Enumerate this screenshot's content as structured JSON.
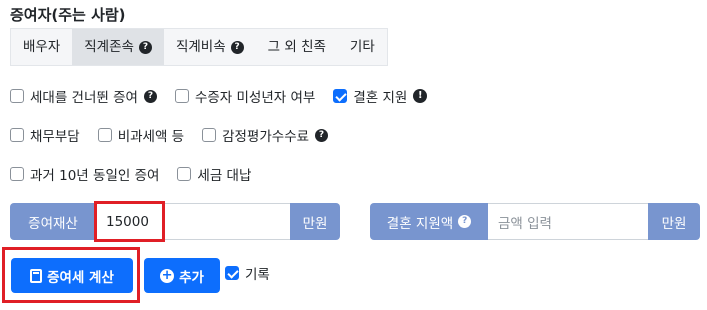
{
  "section": {
    "title": "증여자(주는 사람)"
  },
  "tabs": [
    {
      "label": "배우자",
      "help": false,
      "active": false
    },
    {
      "label": "직계존속",
      "help": true,
      "active": true
    },
    {
      "label": "직계비속",
      "help": true,
      "active": false
    },
    {
      "label": "그 외 친족",
      "help": false,
      "active": false
    },
    {
      "label": "기타",
      "help": false,
      "active": false
    }
  ],
  "options": {
    "row1": [
      {
        "label": "세대를 건너뛴 증여",
        "checked": false,
        "icon": "question-circle-icon"
      },
      {
        "label": "수증자 미성년자 여부",
        "checked": false
      },
      {
        "label": "결혼 지원",
        "checked": true,
        "icon": "exclamation-circle-icon"
      }
    ],
    "row2": [
      {
        "label": "채무부담",
        "checked": false
      },
      {
        "label": "비과세액 등",
        "checked": false
      },
      {
        "label": "감정평가수수료",
        "checked": false,
        "icon": "question-circle-icon"
      }
    ],
    "row3": [
      {
        "label": "과거 10년 동일인 증여",
        "checked": false
      },
      {
        "label": "세금 대납",
        "checked": false
      }
    ]
  },
  "gift_amount": {
    "label": "증여재산",
    "value": "15000",
    "unit": "만원"
  },
  "marriage_support": {
    "label": "결혼 지원액",
    "placeholder": "금액 입력",
    "unit": "만원"
  },
  "actions": {
    "calculate": "증여세 계산",
    "add": "추가",
    "record_label": "기록",
    "record_checked": true
  },
  "colors": {
    "primary": "#0d6efd",
    "addon": "#7895cf",
    "highlight": "#e01f26",
    "tab_bg": "#f5f6f8",
    "tab_active_bg": "#dfe2e6"
  }
}
